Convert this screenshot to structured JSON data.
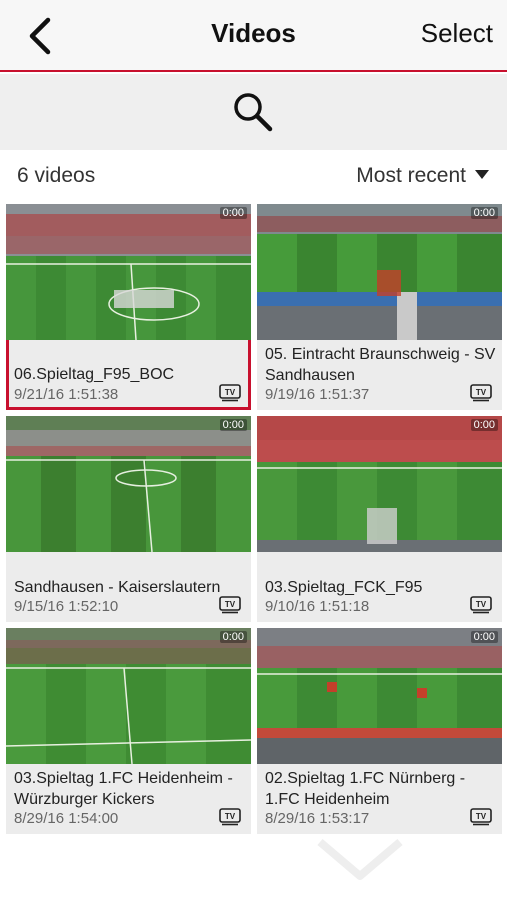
{
  "navbar": {
    "back_icon": "chevron-left-icon",
    "title": "Videos",
    "select_label": "Select"
  },
  "search": {
    "icon": "magnifier-icon"
  },
  "list": {
    "count_label": "6 videos",
    "sort_label": "Most recent",
    "sort_icon": "caret-down-icon"
  },
  "accent_color": "#c8102e",
  "videos": [
    {
      "title": "06.Spieltag_F95_BOC",
      "date": "9/21/16 1:51:38",
      "duration": "0:00",
      "badge": "TV",
      "selected": true
    },
    {
      "title": "05. Eintracht Braunschweig - SV Sandhausen",
      "date": "9/19/16 1:51:37",
      "duration": "0:00",
      "badge": "TV"
    },
    {
      "title": "Sandhausen - Kaiserslautern",
      "date": "9/15/16 1:52:10",
      "duration": "0:00",
      "badge": "TV"
    },
    {
      "title": "03.Spieltag_FCK_F95",
      "date": "9/10/16 1:51:18",
      "duration": "0:00",
      "badge": "TV"
    },
    {
      "title": "03.Spieltag 1.FC Heidenheim - Würzburger Kickers",
      "date": "8/29/16 1:54:00",
      "duration": "0:00",
      "badge": "TV"
    },
    {
      "title": "02.Spieltag 1.FC Nürnberg - 1.FC Heidenheim",
      "date": "8/29/16 1:53:17",
      "duration": "0:00",
      "badge": "TV"
    }
  ]
}
